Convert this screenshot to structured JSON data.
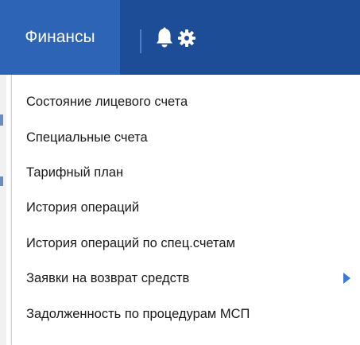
{
  "topbar": {
    "finance_tab_label": "Финансы",
    "icons": [
      "bell-icon",
      "gear-icon"
    ],
    "colors": {
      "bar": "#1d4d96",
      "active_tab": "#2d64b6",
      "text": "#ffffff"
    }
  },
  "menu": {
    "items": [
      {
        "label": "Состояние лицевого счета",
        "has_submenu": false
      },
      {
        "label": "Специальные счета",
        "has_submenu": false
      },
      {
        "label": "Тарифный план",
        "has_submenu": false
      },
      {
        "label": "История операций",
        "has_submenu": false
      },
      {
        "label": "История операций по спец.счетам",
        "has_submenu": false
      },
      {
        "label": "Заявки на возврат средств",
        "has_submenu": true
      },
      {
        "label": "Задолженность по процедурам МСП",
        "has_submenu": false
      }
    ],
    "colors": {
      "text": "#1a1a1a",
      "submenu_arrow": "#3a7bd5"
    }
  }
}
